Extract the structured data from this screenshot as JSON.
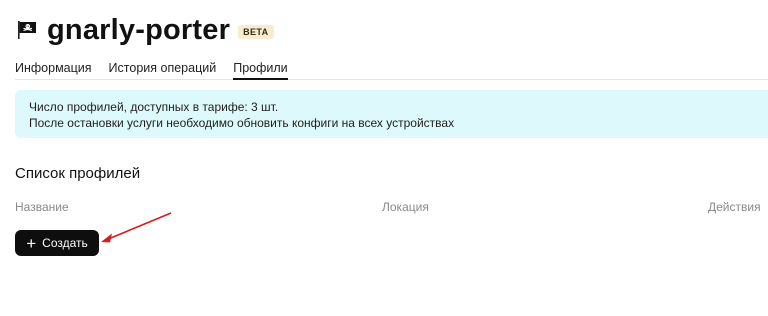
{
  "header": {
    "title": "gnarly-porter",
    "badge": "BETA",
    "icon": "pirate-flag-icon"
  },
  "tabs": [
    {
      "label": "Информация",
      "active": false
    },
    {
      "label": "История операций",
      "active": false
    },
    {
      "label": "Профили",
      "active": true
    }
  ],
  "notice": {
    "line1": "Число профилей, доступных в тарифе: 3 шт.",
    "line2": "После остановки услуги необходимо обновить конфиги на всех устройствах",
    "background": "#ddf9fb"
  },
  "profiles": {
    "section_title": "Список профилей",
    "columns": [
      "Название",
      "Локация",
      "Действия"
    ],
    "create_label": "Создать",
    "create_icon": "plus-icon"
  },
  "annotation": {
    "arrow_color": "#d81b1b"
  }
}
